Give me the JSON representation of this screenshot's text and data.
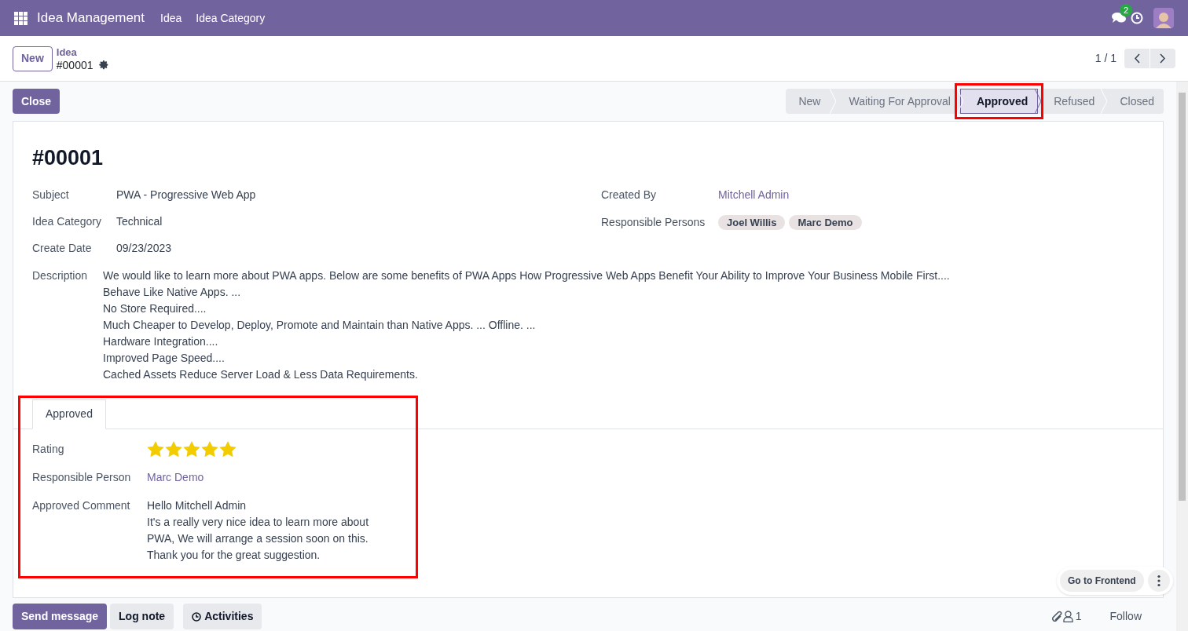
{
  "navbar": {
    "app_name": "Idea Management",
    "menu": [
      "Idea",
      "Idea Category"
    ],
    "message_count": "2"
  },
  "control_panel": {
    "new_button": "New",
    "breadcrumb": "Idea",
    "record": "#00001",
    "pager": "1 / 1"
  },
  "close_button": "Close",
  "stages": [
    {
      "label": "New",
      "selected": false,
      "highlighted": false
    },
    {
      "label": "Waiting For Approval",
      "selected": false,
      "highlighted": false
    },
    {
      "label": "Approved",
      "selected": true,
      "highlighted": true
    },
    {
      "label": "Refused",
      "selected": false,
      "highlighted": false
    },
    {
      "label": "Closed",
      "selected": false,
      "highlighted": false
    }
  ],
  "form": {
    "title": "#00001",
    "left_fields": [
      {
        "label": "Subject",
        "value": "PWA - Progressive Web App"
      },
      {
        "label": "Idea Category",
        "value": "Technical"
      },
      {
        "label": "Create Date",
        "value": "09/23/2023"
      }
    ],
    "created_by": {
      "label": "Created By",
      "value": "Mitchell Admin"
    },
    "responsible_persons": {
      "label": "Responsible Persons",
      "tags": [
        "Joel Willis",
        "Marc Demo"
      ]
    },
    "description": {
      "label": "Description",
      "lines": [
        "We would like to learn more about PWA apps. Below are some benefits of PWA Apps How Progressive Web Apps Benefit Your Ability to Improve Your Business Mobile First....",
        "Behave Like Native Apps. ...",
        "No Store Required....",
        "Much Cheaper to Develop, Deploy, Promote and Maintain than Native Apps. ... Offline. ...",
        "Hardware Integration....",
        "Improved Page Speed....",
        "Cached Assets Reduce Server Load & Less Data Requirements."
      ]
    },
    "tabs": [
      {
        "label": "Approved",
        "selected": true
      }
    ],
    "tab_highlighted": true,
    "approved": {
      "rating_label": "Rating",
      "stars": 5,
      "responsible_label": "Responsible Person",
      "responsible": "Marc Demo",
      "comment_label": "Approved Comment",
      "comment_lines": [
        "Hello Mitchell Admin",
        "It's a really very nice idea to learn more about",
        "PWA, We will arrange a session soon on this.",
        "Thank you for the great suggestion."
      ]
    }
  },
  "frontend": {
    "button": "Go to Frontend"
  },
  "chatter": {
    "buttons": [
      "Send message",
      "Log note",
      "Activities"
    ],
    "followers": "1",
    "follow": "Follow"
  }
}
